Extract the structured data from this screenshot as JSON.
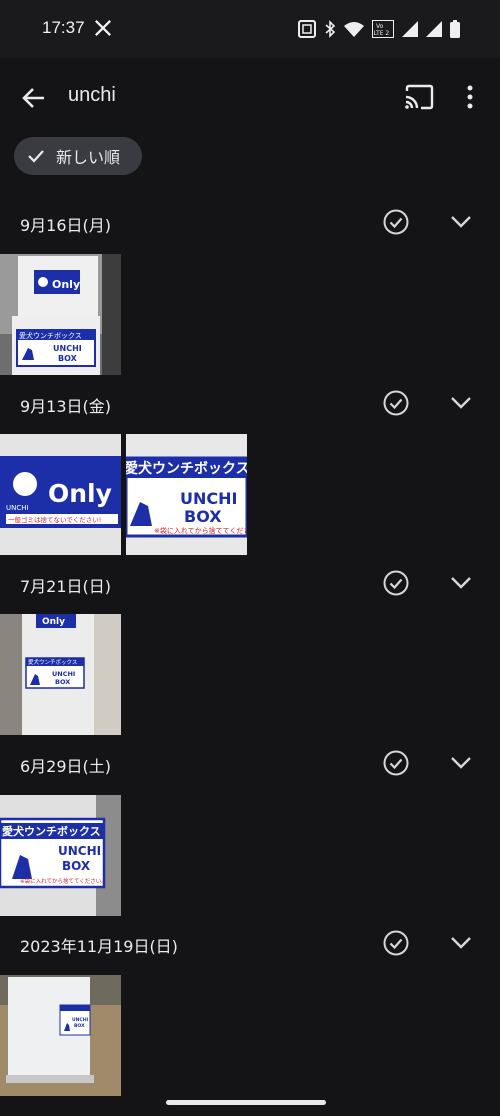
{
  "status_bar": {
    "time": "17:37",
    "icons": [
      "x-logo-icon",
      "nfc-icon",
      "bluetooth-icon",
      "wifi-icon",
      "volte-icon",
      "signal-icon",
      "signal-icon-2",
      "battery-icon"
    ],
    "volte_line1": "Vo",
    "volte_line2": "LTE 2"
  },
  "app_bar": {
    "search_query": "unchi",
    "back_icon": "arrow-back-icon",
    "cast_icon": "cast-icon",
    "more_icon": "more-vert-icon"
  },
  "filter_chip": {
    "label": "新しい順",
    "icon": "check-icon"
  },
  "sections": [
    {
      "date": "9月16日(月)",
      "photos": 1
    },
    {
      "date": "9月13日(金)",
      "photos": 2
    },
    {
      "date": "7月21日(日)",
      "photos": 1
    },
    {
      "date": "6月29日(土)",
      "photos": 1
    },
    {
      "date": "2023年11月19日(日)",
      "photos": 1
    }
  ],
  "photo_text": {
    "only": "Only",
    "unchi_small": "UNCHI",
    "sign_jp": "愛犬ウンチボックス",
    "unchi": "UNCHI",
    "box": "BOX",
    "notice": "一般ゴミは捨てないでください!",
    "bag_notice": "※袋に入れてから捨ててください。"
  },
  "colors": {
    "background": "#141416",
    "chip": "#3a3b40",
    "sign_blue": "#1c2fa8",
    "notice_red": "#d12020"
  }
}
